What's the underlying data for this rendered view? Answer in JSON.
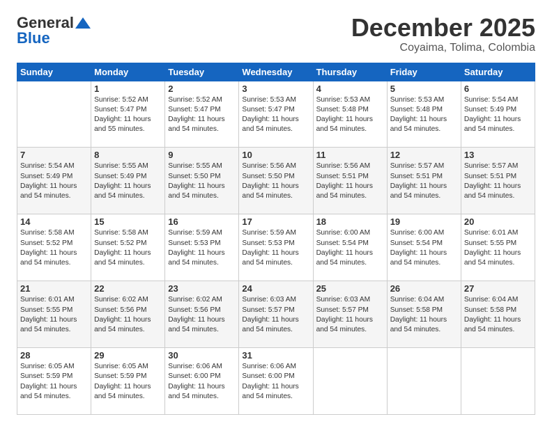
{
  "header": {
    "logo_line1": "General",
    "logo_line2": "Blue",
    "main_title": "December 2025",
    "subtitle": "Coyaima, Tolima, Colombia"
  },
  "calendar": {
    "days_of_week": [
      "Sunday",
      "Monday",
      "Tuesday",
      "Wednesday",
      "Thursday",
      "Friday",
      "Saturday"
    ],
    "weeks": [
      [
        {
          "day": "",
          "info": ""
        },
        {
          "day": "1",
          "info": "Sunrise: 5:52 AM\nSunset: 5:47 PM\nDaylight: 11 hours\nand 55 minutes."
        },
        {
          "day": "2",
          "info": "Sunrise: 5:52 AM\nSunset: 5:47 PM\nDaylight: 11 hours\nand 54 minutes."
        },
        {
          "day": "3",
          "info": "Sunrise: 5:53 AM\nSunset: 5:47 PM\nDaylight: 11 hours\nand 54 minutes."
        },
        {
          "day": "4",
          "info": "Sunrise: 5:53 AM\nSunset: 5:48 PM\nDaylight: 11 hours\nand 54 minutes."
        },
        {
          "day": "5",
          "info": "Sunrise: 5:53 AM\nSunset: 5:48 PM\nDaylight: 11 hours\nand 54 minutes."
        },
        {
          "day": "6",
          "info": "Sunrise: 5:54 AM\nSunset: 5:49 PM\nDaylight: 11 hours\nand 54 minutes."
        }
      ],
      [
        {
          "day": "7",
          "info": "Sunrise: 5:54 AM\nSunset: 5:49 PM\nDaylight: 11 hours\nand 54 minutes."
        },
        {
          "day": "8",
          "info": "Sunrise: 5:55 AM\nSunset: 5:49 PM\nDaylight: 11 hours\nand 54 minutes."
        },
        {
          "day": "9",
          "info": "Sunrise: 5:55 AM\nSunset: 5:50 PM\nDaylight: 11 hours\nand 54 minutes."
        },
        {
          "day": "10",
          "info": "Sunrise: 5:56 AM\nSunset: 5:50 PM\nDaylight: 11 hours\nand 54 minutes."
        },
        {
          "day": "11",
          "info": "Sunrise: 5:56 AM\nSunset: 5:51 PM\nDaylight: 11 hours\nand 54 minutes."
        },
        {
          "day": "12",
          "info": "Sunrise: 5:57 AM\nSunset: 5:51 PM\nDaylight: 11 hours\nand 54 minutes."
        },
        {
          "day": "13",
          "info": "Sunrise: 5:57 AM\nSunset: 5:51 PM\nDaylight: 11 hours\nand 54 minutes."
        }
      ],
      [
        {
          "day": "14",
          "info": "Sunrise: 5:58 AM\nSunset: 5:52 PM\nDaylight: 11 hours\nand 54 minutes."
        },
        {
          "day": "15",
          "info": "Sunrise: 5:58 AM\nSunset: 5:52 PM\nDaylight: 11 hours\nand 54 minutes."
        },
        {
          "day": "16",
          "info": "Sunrise: 5:59 AM\nSunset: 5:53 PM\nDaylight: 11 hours\nand 54 minutes."
        },
        {
          "day": "17",
          "info": "Sunrise: 5:59 AM\nSunset: 5:53 PM\nDaylight: 11 hours\nand 54 minutes."
        },
        {
          "day": "18",
          "info": "Sunrise: 6:00 AM\nSunset: 5:54 PM\nDaylight: 11 hours\nand 54 minutes."
        },
        {
          "day": "19",
          "info": "Sunrise: 6:00 AM\nSunset: 5:54 PM\nDaylight: 11 hours\nand 54 minutes."
        },
        {
          "day": "20",
          "info": "Sunrise: 6:01 AM\nSunset: 5:55 PM\nDaylight: 11 hours\nand 54 minutes."
        }
      ],
      [
        {
          "day": "21",
          "info": "Sunrise: 6:01 AM\nSunset: 5:55 PM\nDaylight: 11 hours\nand 54 minutes."
        },
        {
          "day": "22",
          "info": "Sunrise: 6:02 AM\nSunset: 5:56 PM\nDaylight: 11 hours\nand 54 minutes."
        },
        {
          "day": "23",
          "info": "Sunrise: 6:02 AM\nSunset: 5:56 PM\nDaylight: 11 hours\nand 54 minutes."
        },
        {
          "day": "24",
          "info": "Sunrise: 6:03 AM\nSunset: 5:57 PM\nDaylight: 11 hours\nand 54 minutes."
        },
        {
          "day": "25",
          "info": "Sunrise: 6:03 AM\nSunset: 5:57 PM\nDaylight: 11 hours\nand 54 minutes."
        },
        {
          "day": "26",
          "info": "Sunrise: 6:04 AM\nSunset: 5:58 PM\nDaylight: 11 hours\nand 54 minutes."
        },
        {
          "day": "27",
          "info": "Sunrise: 6:04 AM\nSunset: 5:58 PM\nDaylight: 11 hours\nand 54 minutes."
        }
      ],
      [
        {
          "day": "28",
          "info": "Sunrise: 6:05 AM\nSunset: 5:59 PM\nDaylight: 11 hours\nand 54 minutes."
        },
        {
          "day": "29",
          "info": "Sunrise: 6:05 AM\nSunset: 5:59 PM\nDaylight: 11 hours\nand 54 minutes."
        },
        {
          "day": "30",
          "info": "Sunrise: 6:06 AM\nSunset: 6:00 PM\nDaylight: 11 hours\nand 54 minutes."
        },
        {
          "day": "31",
          "info": "Sunrise: 6:06 AM\nSunset: 6:00 PM\nDaylight: 11 hours\nand 54 minutes."
        },
        {
          "day": "",
          "info": ""
        },
        {
          "day": "",
          "info": ""
        },
        {
          "day": "",
          "info": ""
        }
      ]
    ]
  }
}
